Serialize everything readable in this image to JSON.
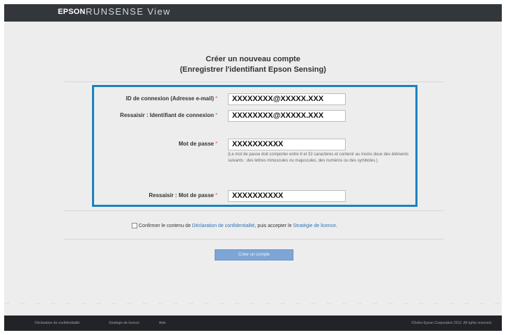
{
  "header": {
    "brand": "EPSON",
    "product": "RUNSENSE View"
  },
  "page": {
    "title_line1": "Créer un nouveau compte",
    "title_line2": "(Enregistrer l'identifiant Epson Sensing)"
  },
  "form": {
    "required_mark": "*",
    "login_id": {
      "label": "ID de connexion (Adresse e-mail)",
      "value": "XXXXXXXX@XXXXX.XXX"
    },
    "login_id_confirm": {
      "label": "Ressaisir : Identifiant de connexion",
      "value": "XXXXXXXX@XXXXX.XXX"
    },
    "password": {
      "label": "Mot de passe",
      "value": "XXXXXXXXXX",
      "hint": "(Le mot de passe doit comporter entre 8 et 32 caractères et contenir au moins deux des éléments suivants : des lettres minuscules ou majuscules, des numéros ou des symboles.)"
    },
    "password_confirm": {
      "label": "Ressaisir : Mot de passe",
      "value": "XXXXXXXXXX"
    }
  },
  "consent": {
    "text1": "Confirmer le contenu de ",
    "link1": "Déclaration de confidentialité",
    "text2": ", puis accepter le ",
    "link2": "Stratégie de licence",
    "text3": "."
  },
  "submit_label": "Créer un compte",
  "footer": {
    "privacy": "Déclaration de confidentialité",
    "license": "Stratégie de licence",
    "help": "Aide",
    "copyright": "©Seiko Epson Corporation 2012. All rights reserved."
  },
  "colors": {
    "accent": "#1a82bd",
    "button": "#7da6d6",
    "topbar": "#33373c",
    "footer": "#212326"
  }
}
